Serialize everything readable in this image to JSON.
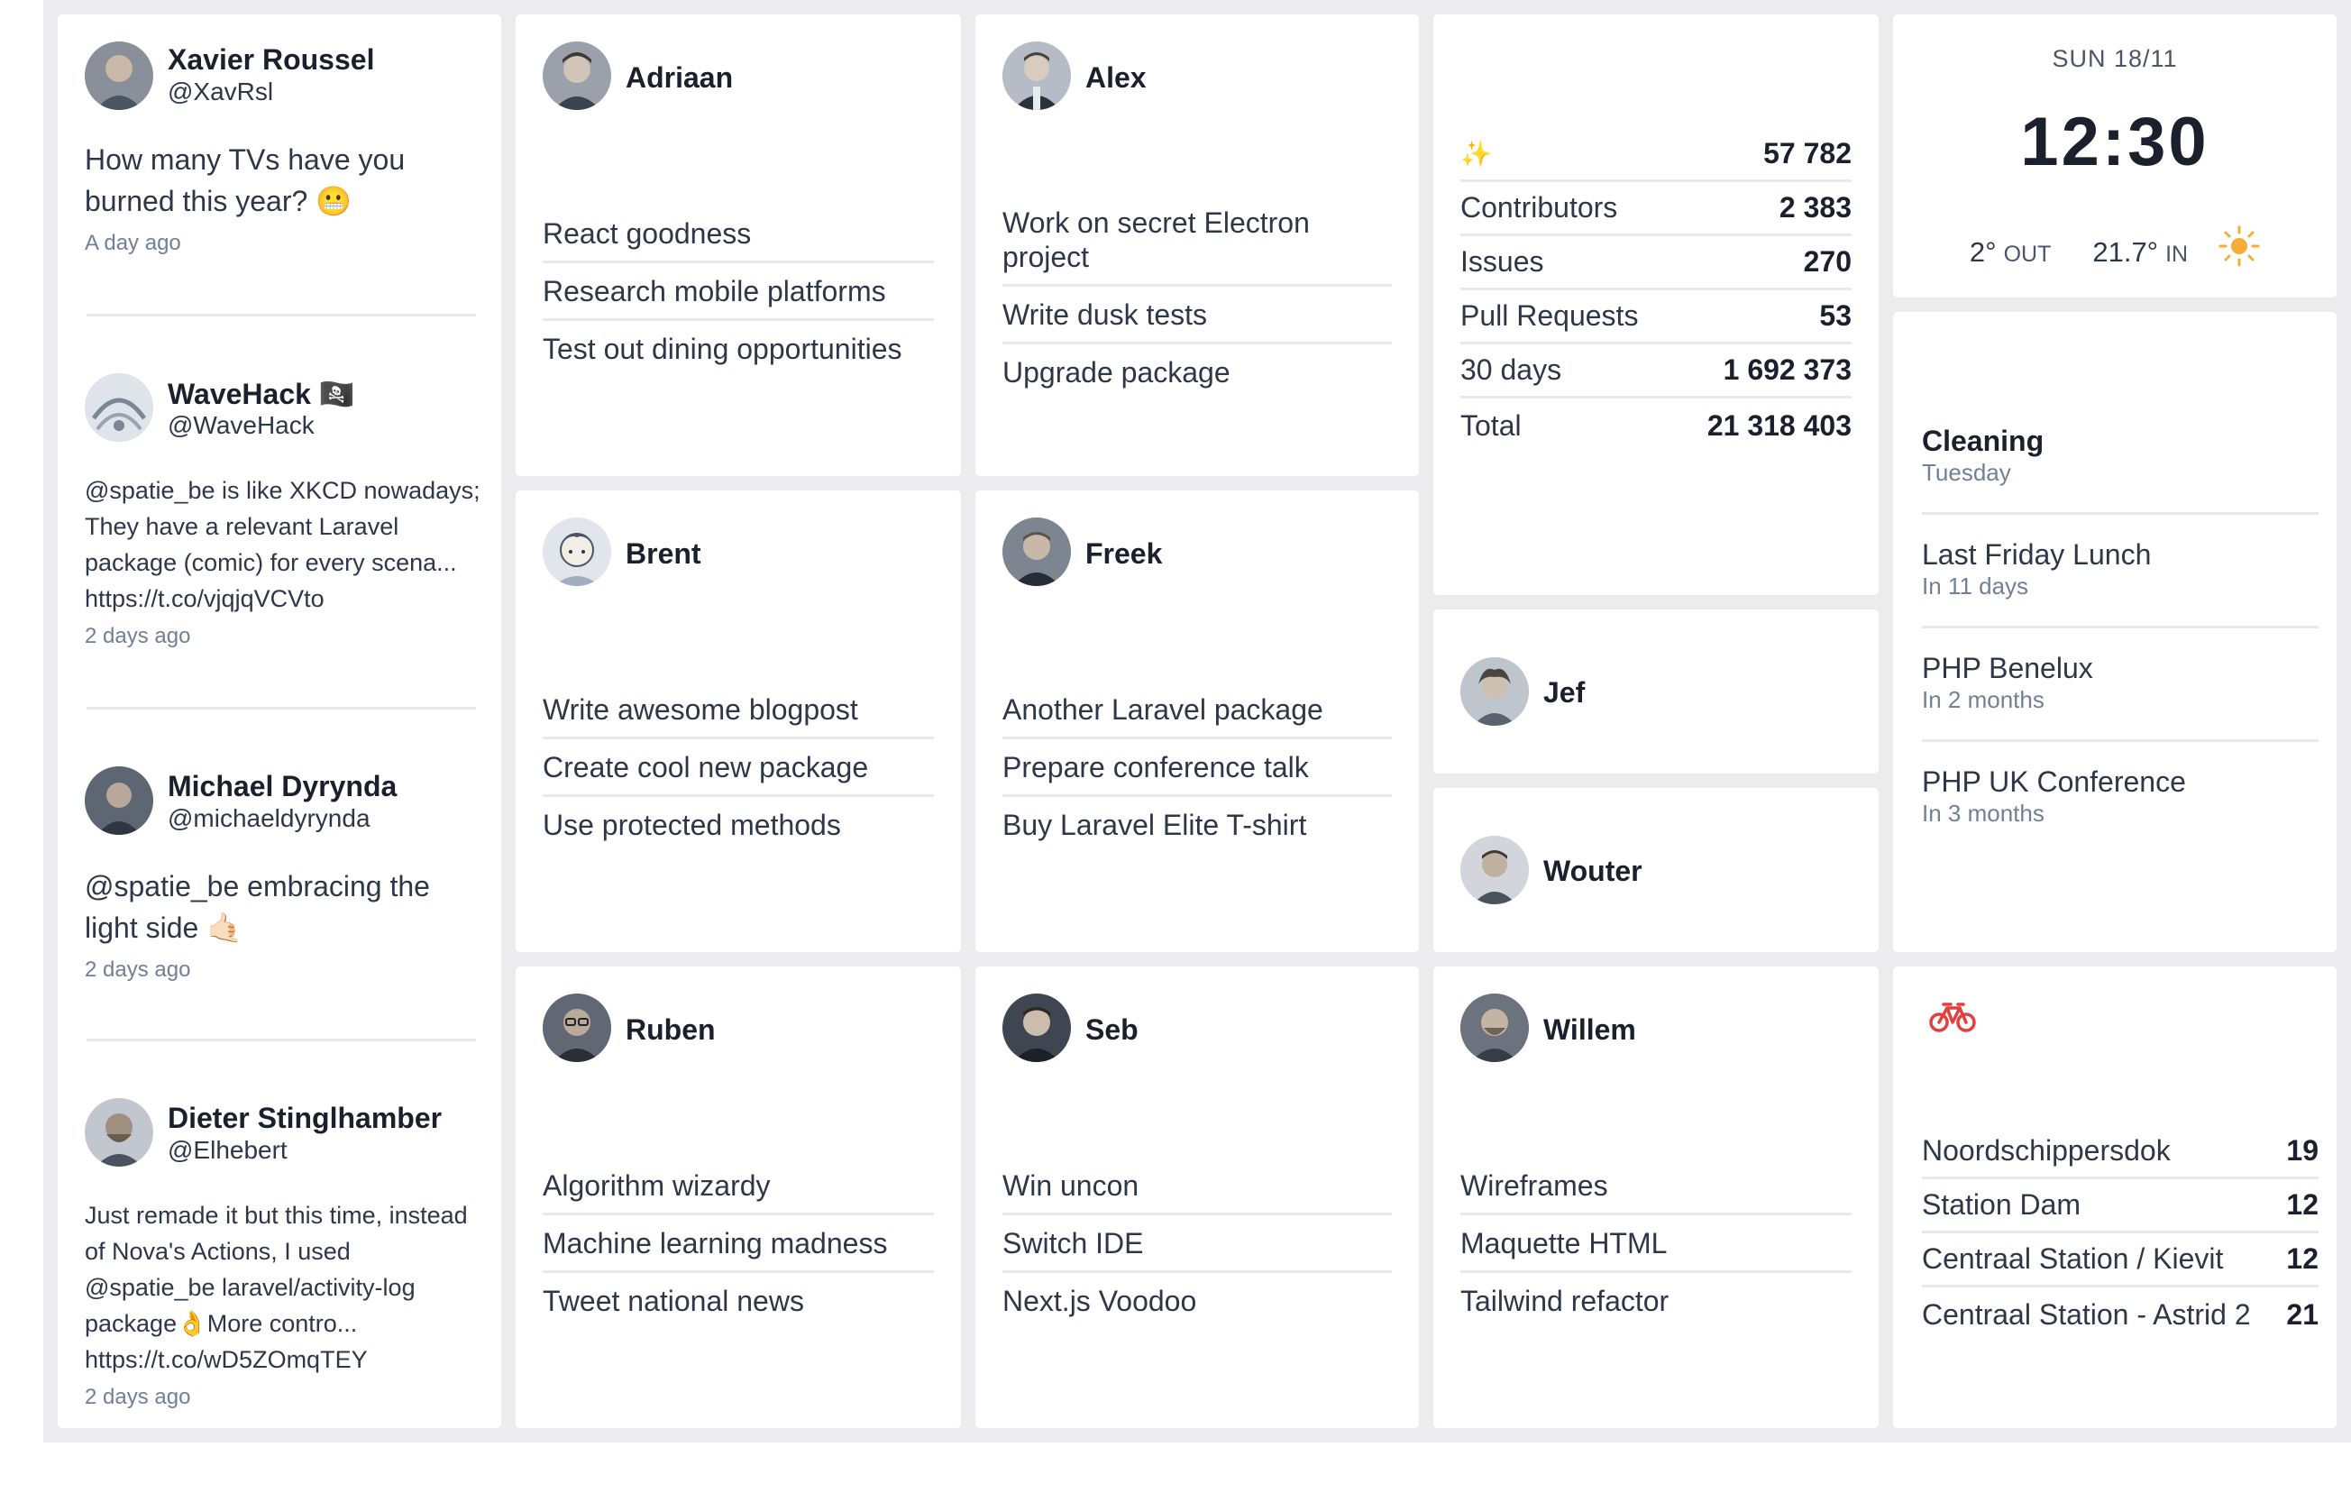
{
  "tweets": [
    {
      "name": "Xavier Roussel",
      "handle": "@XavRsl",
      "text": "How many TVs have you burned this year? 😬",
      "ago": "A day ago"
    },
    {
      "name": "WaveHack 🏴‍☠️",
      "handle": "@WaveHack",
      "text": "@spatie_be is like XKCD nowadays; They have a relevant Laravel package (comic) for every scena... https://t.co/vjqjqVCVto",
      "ago": "2 days ago"
    },
    {
      "name": "Michael Dyrynda",
      "handle": "@michaeldyrynda",
      "text": "@spatie_be embracing the light side 🤙🏻",
      "ago": "2 days ago"
    },
    {
      "name": "Dieter Stinglhamber",
      "handle": "@Elhebert",
      "text": "Just remade it but this time, instead of Nova's Actions, I used @spatie_be laravel/activity-log package👌More contro... https://t.co/wD5ZOmqTEY",
      "ago": "2 days ago"
    }
  ],
  "team": [
    {
      "name": "Adriaan",
      "tasks": [
        "React goodness",
        "Research mobile platforms",
        "Test out dining opportunities"
      ]
    },
    {
      "name": "Alex",
      "tasks": [
        "Work on secret Electron project",
        "Write dusk tests",
        "Upgrade package"
      ]
    },
    {
      "name": "Brent",
      "tasks": [
        "Write awesome blogpost",
        "Create cool new package",
        "Use protected methods"
      ]
    },
    {
      "name": "Freek",
      "tasks": [
        "Another Laravel package",
        "Prepare conference talk",
        "Buy Laravel Elite T-shirt"
      ]
    },
    {
      "name": "Ruben",
      "tasks": [
        "Algorithm wizardy",
        "Machine learning madness",
        "Tweet national news"
      ]
    },
    {
      "name": "Seb",
      "tasks": [
        "Win uncon",
        "Switch IDE",
        "Next.js Voodoo"
      ]
    },
    {
      "name": "Willem",
      "tasks": [
        "Wireframes",
        "Maquette HTML",
        "Tailwind refactor"
      ]
    },
    {
      "name": "Jef",
      "tasks": []
    },
    {
      "name": "Wouter",
      "tasks": []
    }
  ],
  "stats": {
    "stars_icon": "sparkles-icon",
    "stars": "57 782",
    "rows": [
      {
        "label": "Contributors",
        "value": "2 383"
      },
      {
        "label": "Issues",
        "value": "270"
      },
      {
        "label": "Pull Requests",
        "value": "53"
      },
      {
        "label": "30 days",
        "value": "1 692 373"
      },
      {
        "label": "Total",
        "value": "21 318 403"
      }
    ]
  },
  "clock": {
    "date": "SUN 18/11",
    "time": "12:30",
    "temp_out": "2°",
    "out_label": "OUT",
    "temp_in": "21.7°",
    "in_label": "IN",
    "weather_icon": "sun-icon",
    "weather_color": "#f6ad37"
  },
  "calendar": [
    {
      "title": "Cleaning",
      "when": "Tuesday"
    },
    {
      "title": "Last Friday Lunch",
      "when": "In 11 days"
    },
    {
      "title": "PHP Benelux",
      "when": "In 2 months"
    },
    {
      "title": "PHP UK Conference",
      "when": "In 3 months"
    }
  ],
  "velo": {
    "icon": "bicycle-icon",
    "icon_color": "#e53e3e",
    "stations": [
      {
        "name": "Noordschippersdok",
        "count": "19"
      },
      {
        "name": "Station Dam",
        "count": "12"
      },
      {
        "name": "Centraal Station / Kievit",
        "count": "12"
      },
      {
        "name": "Centraal Station - Astrid 2",
        "count": "21"
      }
    ]
  }
}
